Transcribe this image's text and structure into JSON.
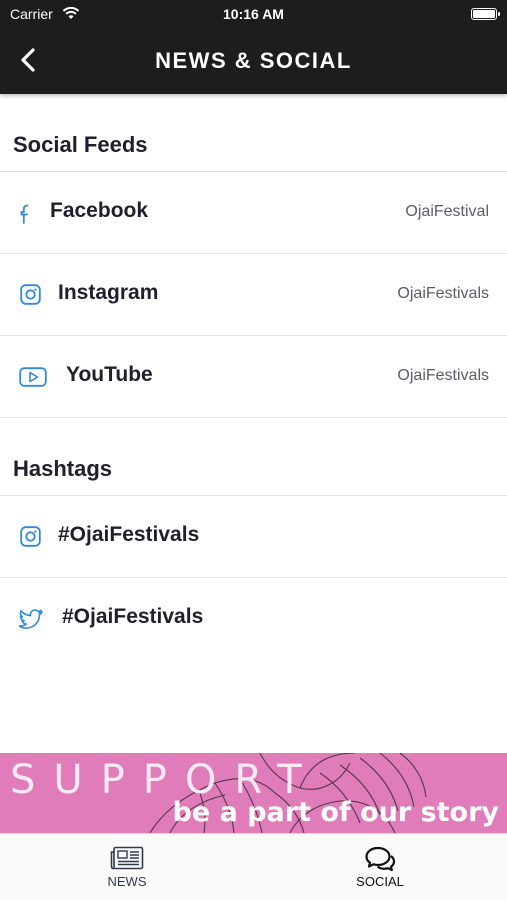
{
  "status_bar": {
    "carrier": "Carrier",
    "time": "10:16 AM"
  },
  "nav": {
    "title": "NEWS & SOCIAL",
    "back_icon": "chevron-left-icon"
  },
  "social_feeds": {
    "header": "Social Feeds",
    "items": [
      {
        "label": "Facebook",
        "handle": "OjaiFestival",
        "icon": "facebook-icon"
      },
      {
        "label": "Instagram",
        "handle": "OjaiFestivals",
        "icon": "instagram-icon"
      },
      {
        "label": "YouTube",
        "handle": "OjaiFestivals",
        "icon": "youtube-icon"
      }
    ]
  },
  "hashtags": {
    "header": "Hashtags",
    "items": [
      {
        "label": "#OjaiFestivals",
        "icon": "instagram-icon"
      },
      {
        "label": "#OjaiFestivals",
        "icon": "twitter-icon"
      }
    ]
  },
  "banner": {
    "word": "SUPPORT",
    "tagline": "be a part of our story"
  },
  "tabs": [
    {
      "label": "NEWS",
      "icon": "newspaper-icon",
      "selected": false
    },
    {
      "label": "SOCIAL",
      "icon": "chat-bubbles-icon",
      "selected": true
    }
  ],
  "colors": {
    "accent": "#2d8ae0",
    "nav_background": "#1d1d1d",
    "banner_background": "#e07cb9"
  }
}
